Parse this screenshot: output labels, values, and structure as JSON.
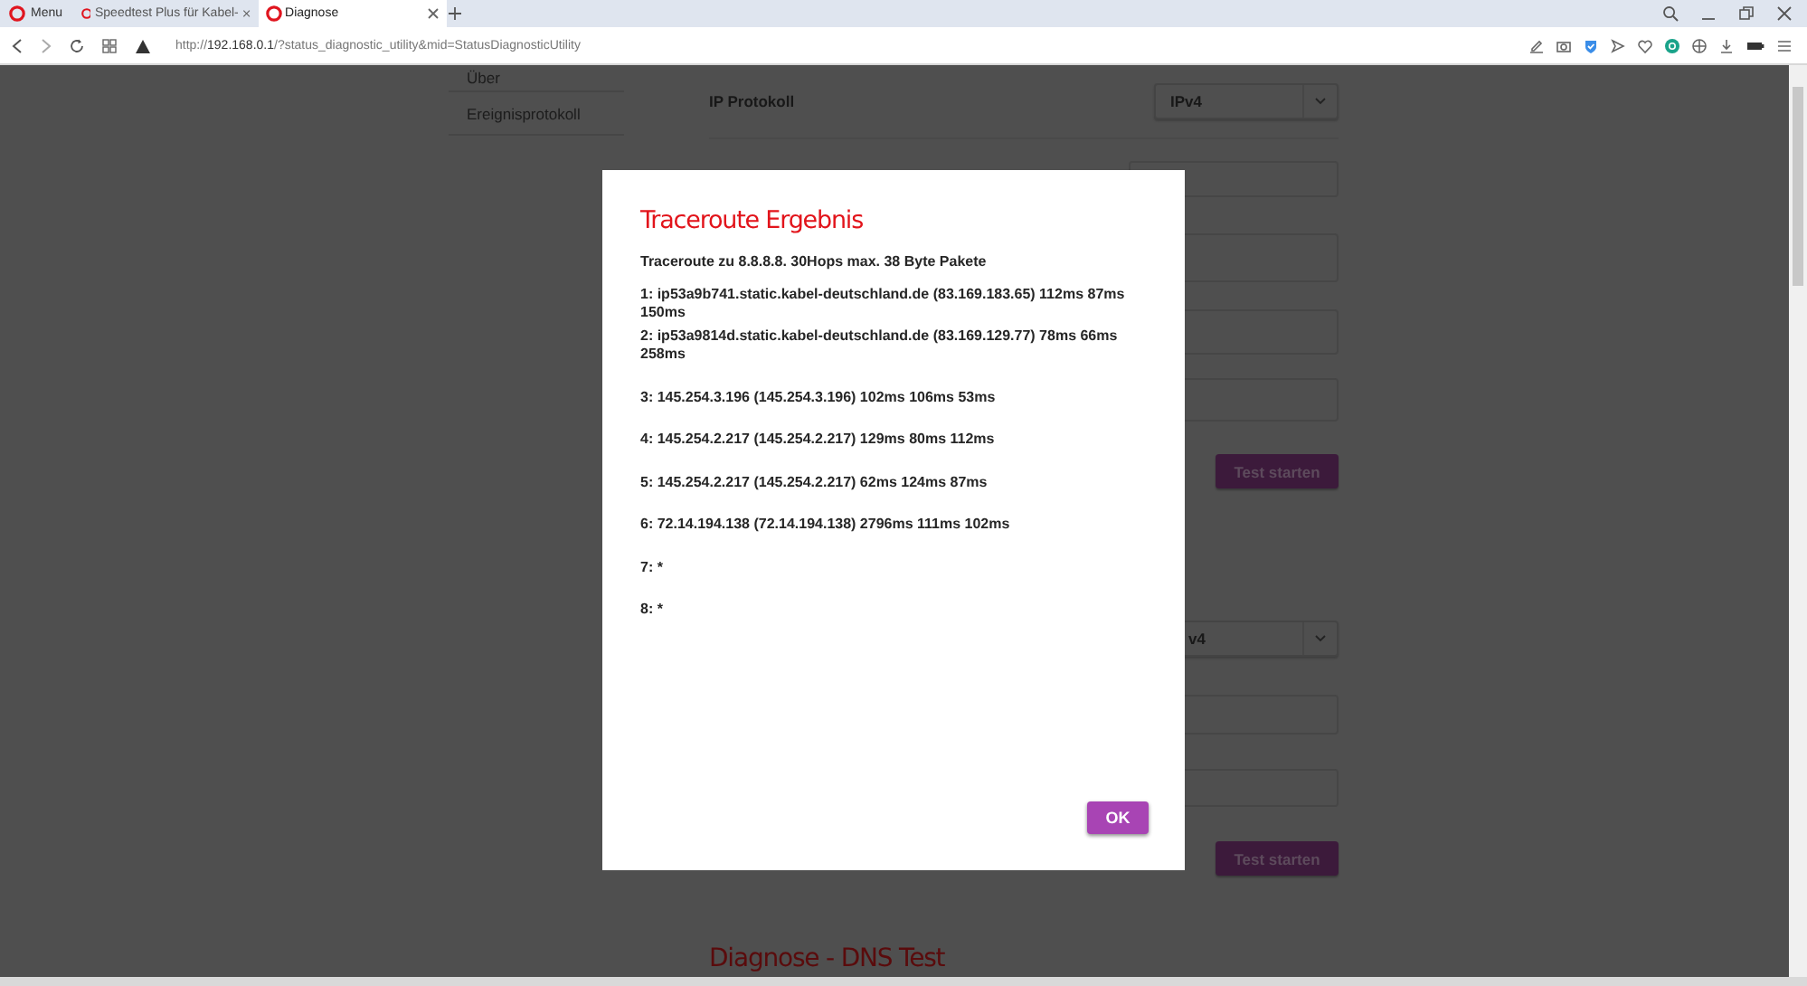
{
  "browser": {
    "menu_label": "Menu",
    "tabs": [
      {
        "title": "Speedtest Plus für Kabel-",
        "selected": false
      },
      {
        "title": "Diagnose",
        "selected": true
      }
    ],
    "url": "http://**192.168.0.1**/?status_diagnostic_utility&mid=StatusDiagnosticUtility"
  },
  "sidebar": {
    "items": [
      "Über",
      "Ereignisprotokoll"
    ]
  },
  "traceroute_form": {
    "ip_protocol_label": "IP Protokoll",
    "ip_protocol_value": "IPv4",
    "start_button": "Test starten"
  },
  "second_form": {
    "ip_protocol_value": "v4",
    "start_button": "Test starten"
  },
  "dns_heading": "Diagnose - DNS Test",
  "dialog": {
    "title": "Traceroute Ergebnis",
    "summary": "Traceroute zu 8.8.8.8. 30Hops max. 38 Byte Pakete",
    "hops": [
      "1: ip53a9b741.static.kabel-deutschland.de (83.169.183.65) 112ms 87ms 150ms",
      "2: ip53a9814d.static.kabel-deutschland.de (83.169.129.77) 78ms 66ms 258ms",
      "3: 145.254.3.196 (145.254.3.196) 102ms 106ms 53ms",
      "4: 145.254.2.217 (145.254.2.217) 129ms 80ms 112ms",
      "5: 145.254.2.217 (145.254.2.217) 62ms 124ms 87ms",
      "6: 72.14.194.138 (72.14.194.138) 2796ms 111ms 102ms",
      "7: *",
      "8: *"
    ],
    "ok_button": "OK"
  }
}
